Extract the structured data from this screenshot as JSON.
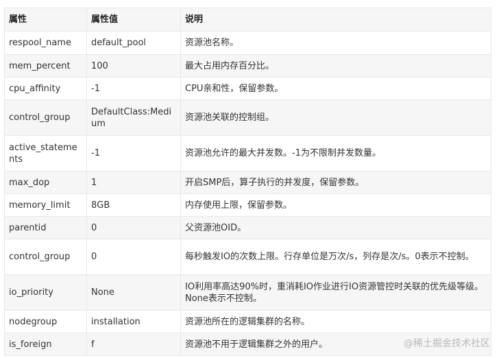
{
  "headers": [
    "属性",
    "属性值",
    "说明"
  ],
  "rows": [
    {
      "name": "respool_name",
      "value": "default_pool",
      "desc": "资源池名称。",
      "h": 34
    },
    {
      "name": "mem_percent",
      "value": "100",
      "desc": "最大占用内存百分比。",
      "h": 33
    },
    {
      "name": "cpu_affinity",
      "value": "-1",
      "desc": "CPU亲和性，保留参数。",
      "h": 33
    },
    {
      "name": "control_group",
      "value": "DefaultClass:Medium",
      "desc": "资源池关联的控制组。",
      "h": 52
    },
    {
      "name": "active_statements",
      "value": "-1",
      "desc": "资源池允许的最大并发数。-1为不限制并发数量。",
      "h": 52
    },
    {
      "name": "max_dop",
      "value": "1",
      "desc": "开启SMP后，算子执行的并发度，保留参数。",
      "h": 33
    },
    {
      "name": "memory_limit",
      "value": "8GB",
      "desc": "内存使用上限，保留参数。",
      "h": 33
    },
    {
      "name": "parentid",
      "value": "0",
      "desc": "父资源池OID。",
      "h": 33
    },
    {
      "name": "control_group",
      "value": "0",
      "desc": "每秒触发IO的次数上限。行存单位是万次/s，列存是次/s。0表示不控制。",
      "h": 52
    },
    {
      "name": "io_priority",
      "value": "None",
      "desc": "IO利用率高达90%时，重消耗IO作业进行IO资源管控时关联的优先级等级。None表示不控制。",
      "h": 52
    },
    {
      "name": "nodegroup",
      "value": "installation",
      "desc": "资源池所在的逻辑集群的名称。",
      "h": 33
    },
    {
      "name": "is_foreign",
      "value": "f",
      "desc": "资源池不用于逻辑集群之外的用户。",
      "h": 33
    }
  ],
  "watermark": "@稀土掘金技术社区"
}
